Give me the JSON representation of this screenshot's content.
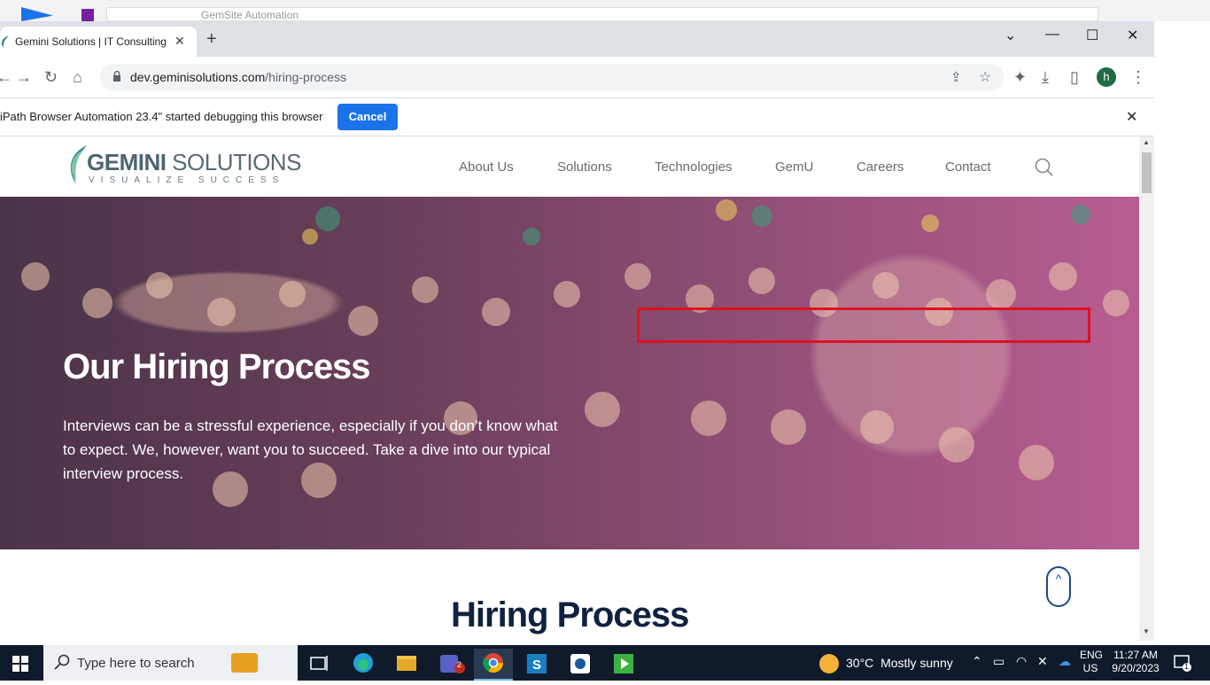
{
  "background_app": {
    "title": "GemSite Automation"
  },
  "browser": {
    "tab": {
      "title": "Gemini Solutions | IT Consulting",
      "close": "✕"
    },
    "new_tab": "+",
    "window_controls": {
      "dropdown": "⌄",
      "minimize": "—",
      "maximize": "☐",
      "close": "✕"
    },
    "url_domain": "dev.geminisolutions.com",
    "url_path": "/hiring-process",
    "profile_initial": "h",
    "infobar": {
      "message": "iPath Browser Automation 23.4\" started debugging this browser",
      "cancel_label": "Cancel",
      "close": "✕"
    }
  },
  "site": {
    "logo_main_1": "GEMINI",
    "logo_main_2": " SOLUTIONS",
    "logo_tagline": "VISUALIZE SUCCESS",
    "nav": [
      "About Us",
      "Solutions",
      "Technologies",
      "GemU",
      "Careers",
      "Contact"
    ],
    "hero": {
      "title": "Our Hiring Process",
      "text": "Interviews can be a stressful experience, especially if you don’t know what to expect. We, however, want you to succeed. Take a dive into our typical interview process."
    },
    "section_title": "Hiring Process",
    "scroll_top_glyph": "^"
  },
  "taskbar": {
    "search_placeholder": "Type here to search",
    "teams_badge": "2",
    "weather": {
      "temp": "30°C",
      "condition": "Mostly sunny"
    },
    "language": {
      "line1": "ENG",
      "line2": "US"
    },
    "clock": {
      "time": "11:27 AM",
      "date": "9/20/2023"
    },
    "notification_count": "1"
  },
  "colors": {
    "accent_blue": "#1a73e8",
    "highlight_red": "#e0101f",
    "site_title_navy": "#10223f",
    "taskbar": "#0f1b2b"
  }
}
